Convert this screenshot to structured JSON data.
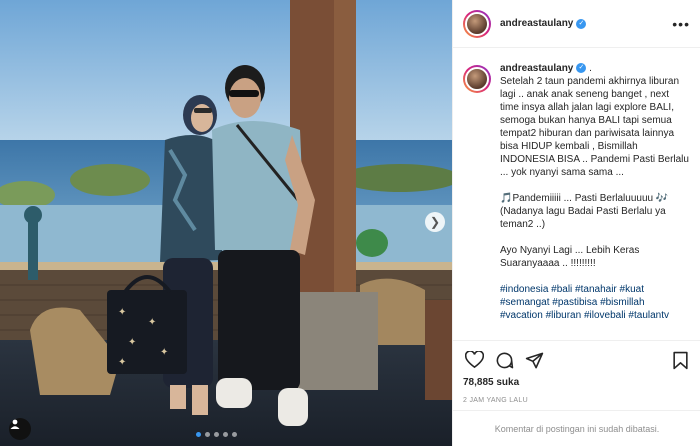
{
  "post": {
    "username": "andreastaulany",
    "verified_icon": "verified-badge-icon",
    "more_icon": "more-options-icon",
    "caption_text": "Setelah 2 taun pandemi akhirnya liburan lagi .. anak anak seneng banget , next time insya allah jalan lagi explore BALI, semoga bukan hanya BALI tapi semua tempat2 hiburan dan pariwisata lainnya bisa HIDUP kembali , Bismillah INDONESIA BISA .. Pandemi Pasti Berlalu ... yok nyanyi sama sama ...\n\n🎵Pandemiiiii ... Pasti Berlaluuuuu 🎶\n(Nadanya lagu Badai Pasti Berlalu ya teman2 ..)\n\nAyo Nyanyi Lagi ... Lebih Keras Suaranyaaaa .. !!!!!!!!!\n\n",
    "hashtags": "#indonesia #bali #tanahair #kuat #semangat #pastibisa #bismillah #vacation #liburan #ilovebali #taulantv",
    "likes": "78,885 suka",
    "time_ago": "2 JAM YANG LALU",
    "comments_disabled": "Komentar di postingan ini sudah dibatasi.",
    "icons": {
      "like": "heart-icon",
      "comment": "comment-icon",
      "share": "share-icon",
      "save": "bookmark-icon",
      "next": "chevron-right-icon",
      "tag": "user-tag-icon"
    },
    "carousel": {
      "count": 5,
      "active": 0
    }
  },
  "colors": {
    "accent": "#3897f0",
    "hashtag": "#00376b",
    "muted": "#8e8e8e",
    "text": "#262626"
  }
}
